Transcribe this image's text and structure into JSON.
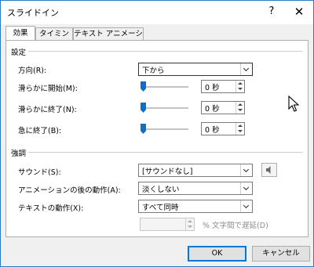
{
  "window": {
    "title": "スライドイン",
    "help_label": "?",
    "close_label": "✕"
  },
  "tabs": [
    {
      "label": "効果",
      "active": true
    },
    {
      "label": "タイミング",
      "active": false
    },
    {
      "label": "テキスト アニメーション",
      "active": false
    }
  ],
  "settings": {
    "section_label": "設定",
    "direction": {
      "label": "方向(R):",
      "value": "下から"
    },
    "smooth_start": {
      "label": "滑らかに開始(M):",
      "value": "0 秒"
    },
    "smooth_end": {
      "label": "滑らかに終了(N):",
      "value": "0 秒"
    },
    "bounce_end": {
      "label": "急に終了(B):",
      "value": "0 秒"
    }
  },
  "enhancements": {
    "section_label": "強調",
    "sound": {
      "label": "サウンド(S):",
      "value": "[サウンドなし]",
      "icon": "speaker-icon"
    },
    "after_animation": {
      "label": "アニメーションの後の動作(A):",
      "value": "淡くしない"
    },
    "animate_text": {
      "label": "テキストの動作(X):",
      "value": "すべて同時"
    },
    "delay": {
      "value": "",
      "suffix": "% 文字間で遅延(D)",
      "enabled": false
    }
  },
  "footer": {
    "ok_label": "OK",
    "cancel_label": "キャンセル"
  },
  "colors": {
    "accent": "#0078d7",
    "slider_thumb": "#0f6fc6",
    "window_border": "#2b79c2"
  }
}
